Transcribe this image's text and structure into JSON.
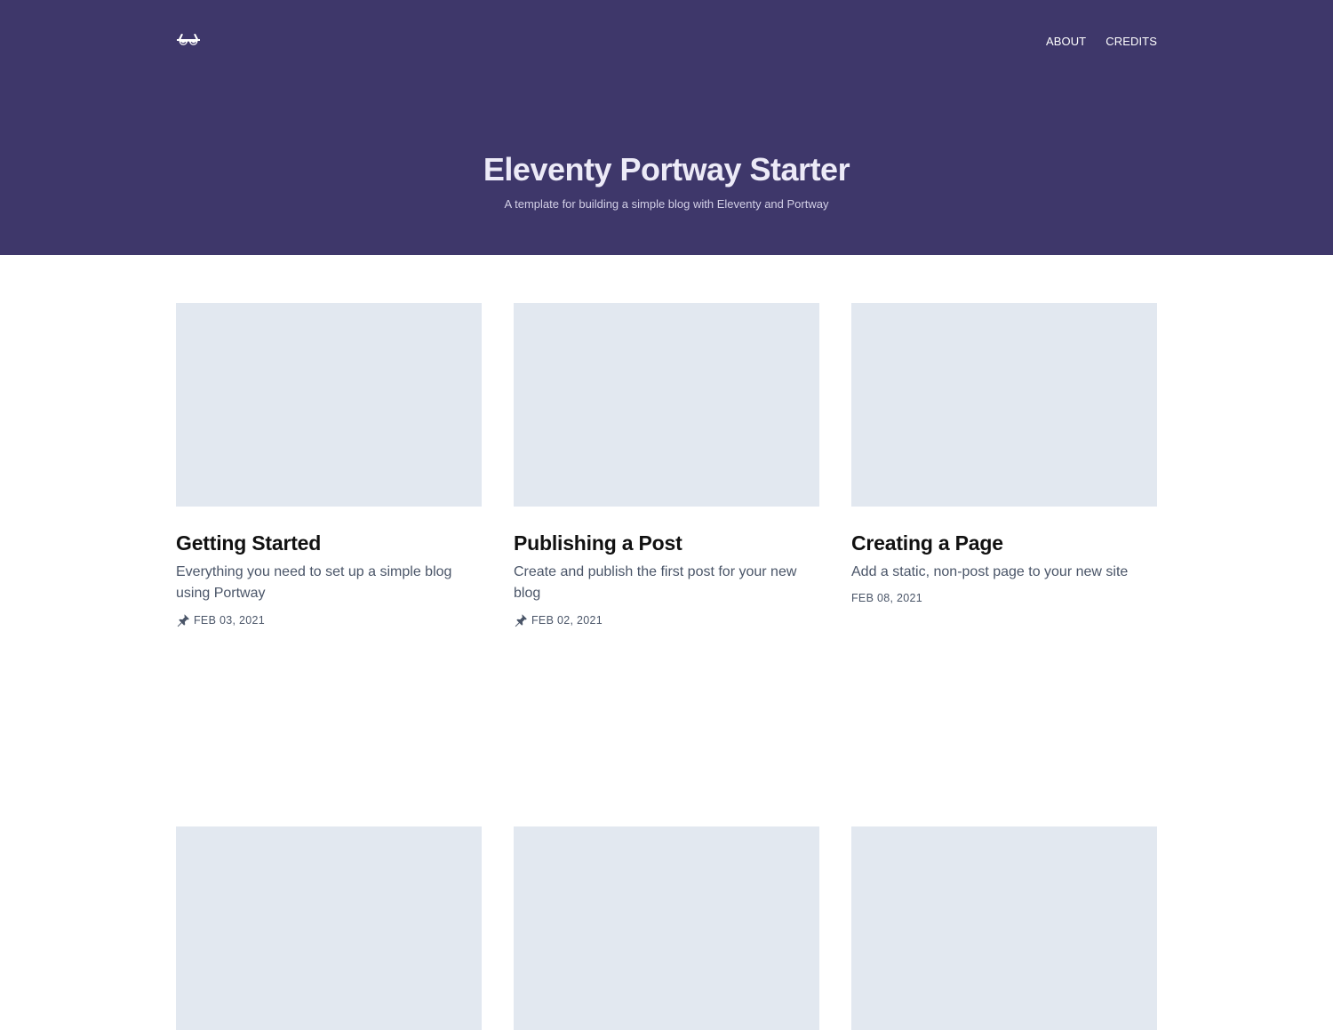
{
  "header": {
    "logo_icon": "sunglasses-icon",
    "nav": [
      {
        "label": "ABOUT"
      },
      {
        "label": "CREDITS"
      }
    ]
  },
  "hero": {
    "title": "Eleventy Portway Starter",
    "subtitle": "A template for building a simple blog with Eleventy and Portway"
  },
  "posts": [
    {
      "title": "Getting Started",
      "description": "Everything you need to set up a simple blog using Portway",
      "date": "FEB 03, 2021",
      "pinned": true
    },
    {
      "title": "Publishing a Post",
      "description": "Create and publish the first post for your new blog",
      "date": "FEB 02, 2021",
      "pinned": true
    },
    {
      "title": "Creating a Page",
      "description": "Add a static, non-post page to your new site",
      "date": "FEB 08, 2021",
      "pinned": false
    }
  ],
  "colors": {
    "hero_bg": "#3e376a",
    "thumb_placeholder": "#e2e8f0",
    "text_muted": "#4a5568"
  }
}
